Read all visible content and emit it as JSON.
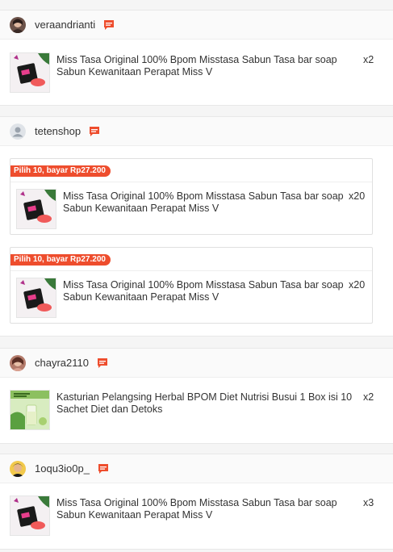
{
  "orders": [
    {
      "username": "veraandrianti",
      "items": [
        {
          "name": "Miss Tasa Original 100% Bpom Misstasa Sabun Tasa bar soap Sabun Kewanitaan Perapat Miss V",
          "qty": "x2"
        }
      ]
    },
    {
      "username": "tetenshop",
      "bundles": [
        {
          "label": "Pilih 10, bayar Rp27.200",
          "name": "Miss Tasa Original 100% Bpom Misstasa Sabun Tasa bar soap Sabun Kewanitaan Perapat Miss V",
          "qty": "x20"
        },
        {
          "label": "Pilih 10, bayar Rp27.200",
          "name": "Miss Tasa Original 100% Bpom Misstasa Sabun Tasa bar soap Sabun Kewanitaan Perapat Miss V",
          "qty": "x20"
        }
      ]
    },
    {
      "username": "chayra2110",
      "items": [
        {
          "name": "Kasturian Pelangsing Herbal BPOM Diet Nutrisi Busui 1 Box isi 10 Sachet Diet dan Detoks",
          "qty": "x2"
        }
      ]
    },
    {
      "username": "1oqu3io0p_",
      "items": [
        {
          "name": "Miss Tasa Original 100% Bpom Misstasa Sabun Tasa bar soap Sabun Kewanitaan Perapat Miss V",
          "qty": "x3"
        }
      ]
    }
  ],
  "colors": {
    "accent": "#ee4d2d",
    "border": "#e8e8e8",
    "header_bg": "#fafafa"
  },
  "icons": {
    "chat": "chat-icon",
    "avatar_default": "default-avatar-icon"
  }
}
